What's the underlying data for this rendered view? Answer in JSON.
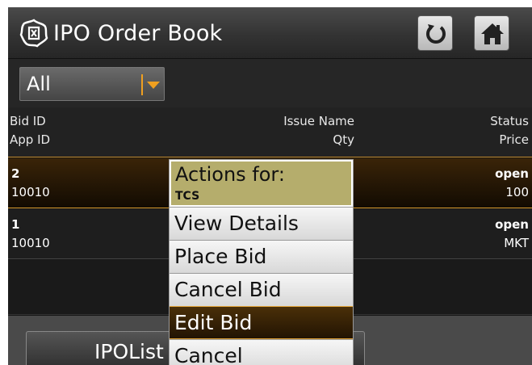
{
  "header": {
    "title": "IPO Order Book",
    "logo_icon": "lotus-logo-icon",
    "refresh_icon": "refresh-icon",
    "home_icon": "home-icon"
  },
  "filter": {
    "value": "All",
    "icon": "chevron-down-icon",
    "accent": "#f0a020"
  },
  "columns": {
    "bid_id": "Bid ID",
    "app_id": "App ID",
    "issue_name": "Issue Name",
    "qty": "Qty",
    "status": "Status",
    "price": "Price"
  },
  "rows": [
    {
      "bid_id": "2",
      "app_id": "10010",
      "status": "open",
      "price": "100"
    },
    {
      "bid_id": "1",
      "app_id": "10010",
      "status": "open",
      "price": "MKT"
    }
  ],
  "menu": {
    "title": "Actions for:",
    "subtitle": "TCS",
    "items": [
      "View Details",
      "Place Bid",
      "Cancel Bid",
      "Edit Bid",
      "Cancel"
    ],
    "selected": "Edit Bid"
  },
  "bottom": {
    "button_label": "IPOList"
  },
  "colors": {
    "accent": "#d79b2e",
    "menu_header": "#b5ad6c"
  }
}
